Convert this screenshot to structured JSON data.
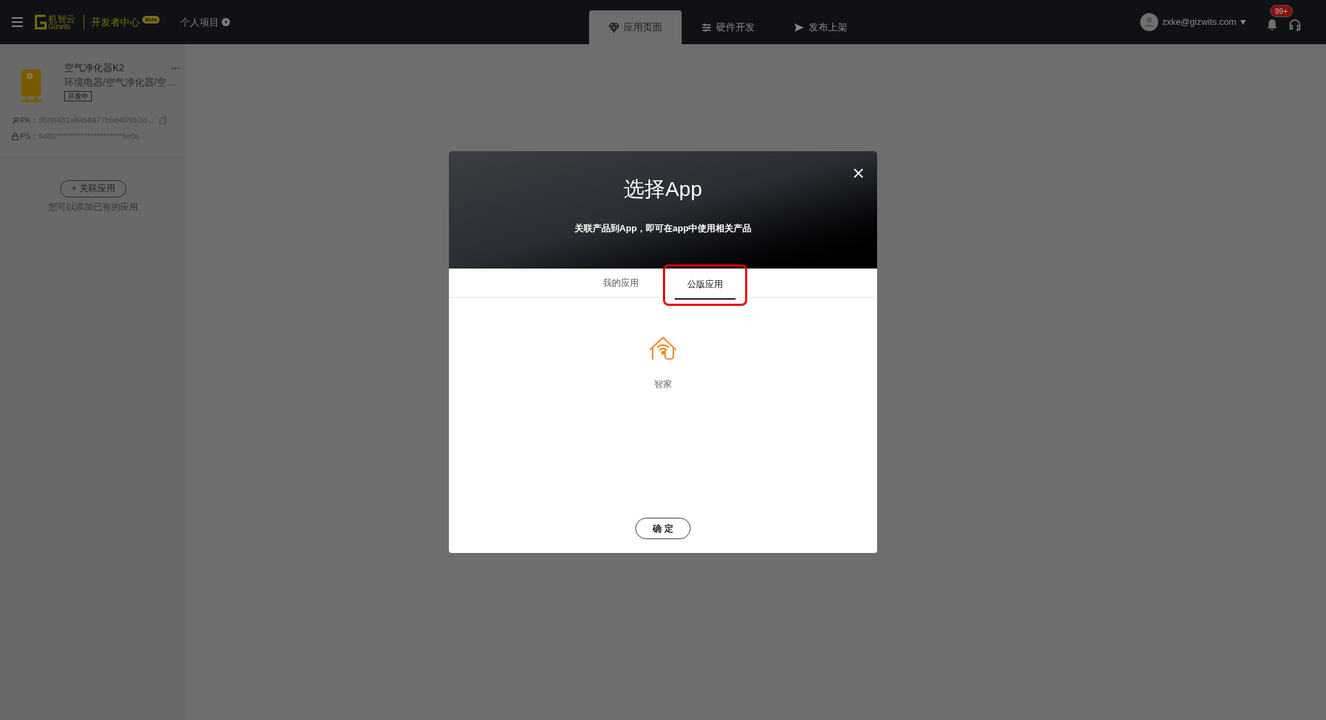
{
  "topbar": {
    "brand_cn": "机智云",
    "brand_en": "Gizwits",
    "section": "开发者中心",
    "section_badge": "Beta",
    "project": "个人项目",
    "nav": [
      {
        "label": "应用页面",
        "kind": "diamond",
        "selected": true
      },
      {
        "label": "硬件开发",
        "kind": "sliders",
        "selected": false
      },
      {
        "label": "发布上架",
        "kind": "send",
        "selected": false
      }
    ],
    "user": "zxke@gizwits.com",
    "notification_count": "99+"
  },
  "product": {
    "name": "空气净化器K2",
    "category": "环境电器/空气净化器/空…",
    "status": "开发中",
    "more": "···",
    "pk_label": "PK：",
    "pk": "8506481a8458477bbd4f70b3d…",
    "ps_label": "PS：",
    "ps": "6d81*********************5e0a"
  },
  "sidebar": {
    "link_button": "+ 关联应用",
    "hint": "您可以添加已有的应用"
  },
  "dialog": {
    "title": "选择App",
    "subtitle": "关联产品到App，即可在app中使用相关产品",
    "tabs": [
      {
        "label": "我的应用",
        "selected": false,
        "highlighted": false
      },
      {
        "label": "公版应用",
        "selected": true,
        "highlighted": true
      }
    ],
    "apps": [
      {
        "name": "智家"
      }
    ],
    "confirm": "确 定"
  }
}
